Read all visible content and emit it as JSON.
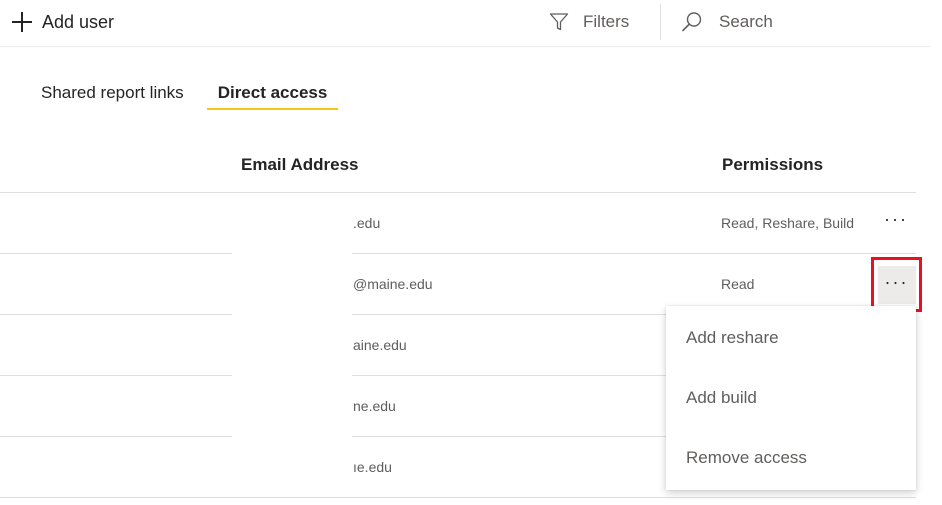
{
  "toolbar": {
    "add_user_label": "Add user",
    "filters_label": "Filters",
    "search_placeholder": "Search"
  },
  "tabs": [
    {
      "label": "Shared report links",
      "active": false
    },
    {
      "label": "Direct access",
      "active": true
    }
  ],
  "table": {
    "columns": [
      "Email Address",
      "Permissions"
    ],
    "rows": [
      {
        "email": ".edu",
        "permissions": "Read, Reshare, Build"
      },
      {
        "email": "@maine.edu",
        "permissions": "Read"
      },
      {
        "email": "aine.edu",
        "permissions": ""
      },
      {
        "email": "ne.edu",
        "permissions": ""
      },
      {
        "email": "ıe.edu",
        "permissions": ""
      }
    ],
    "more_options_label": "···"
  },
  "context_menu": {
    "items": [
      "Add reshare",
      "Add build",
      "Remove access"
    ]
  },
  "colors": {
    "tab_underline": "#f2c811",
    "highlight_border": "#e81123",
    "text_primary": "#252423",
    "text_secondary": "#605e5c",
    "divider": "#e1dfdd"
  },
  "icons": {
    "add": "plus-icon",
    "filter": "filter-icon",
    "search": "search-icon",
    "more": "more-options-icon"
  }
}
